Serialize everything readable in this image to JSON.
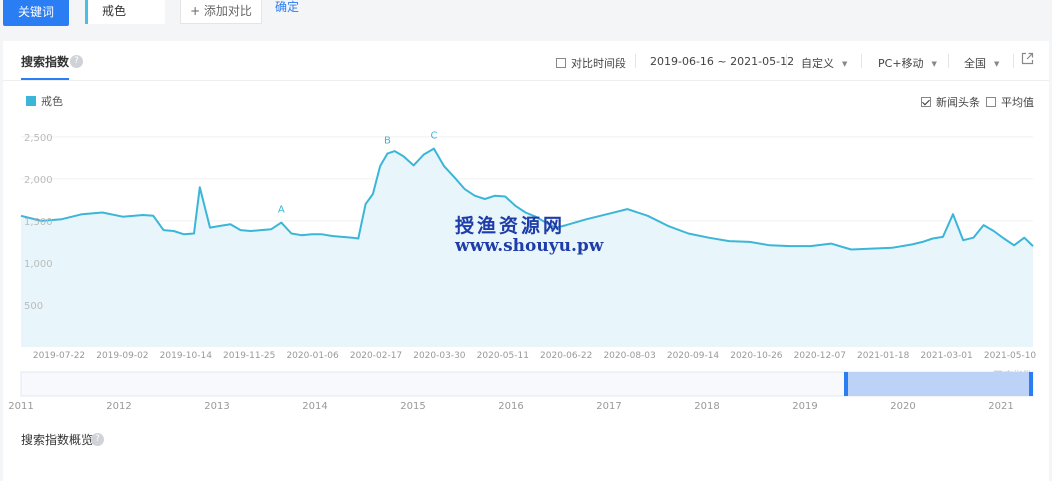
{
  "topbar": {
    "keyword_button": "关键词",
    "keyword_value": "戒色",
    "add_compare": "+ 添加对比",
    "confirm": "确定"
  },
  "panel": {
    "title": "搜索指数",
    "help_icon": "question-circle-icon",
    "compare_period_label": "对比时间段",
    "date_range": "2019-06-16 ~ 2021-05-12",
    "custom_select": "自定义",
    "device_select": "PC+移动",
    "region_select": "全国",
    "export_icon": "external-link-icon",
    "overview_title": "搜索指数概览"
  },
  "chart_options": {
    "news_headlines": {
      "label": "新闻头条",
      "checked": true
    },
    "average": {
      "label": "平均值",
      "checked": false
    }
  },
  "watermark": {
    "line1": "授渔资源网",
    "line2": "www.shouyu.pw"
  },
  "baidu_mark": "@百度指数",
  "colors": {
    "accent": "#2b7df4",
    "series": "#3bb5d8",
    "area_fill": "#e8f6fb",
    "slider_fill": "#bcd3f7"
  },
  "chart_data": {
    "type": "area",
    "title": "",
    "xlabel": "",
    "ylabel": "",
    "ylim": [
      0,
      2700
    ],
    "yticks": [
      "500",
      "1,000",
      "1,500",
      "2,000",
      "2,500"
    ],
    "ytick_values": [
      500,
      1000,
      1500,
      2000,
      2500
    ],
    "xtick_labels": [
      "2019-07-22",
      "2019-09-02",
      "2019-10-14",
      "2019-11-25",
      "2020-01-06",
      "2020-02-17",
      "2020-03-30",
      "2020-05-11",
      "2020-06-22",
      "2020-08-03",
      "2020-09-14",
      "2020-10-26",
      "2020-12-07",
      "2021-01-18",
      "2021-03-01",
      "2021-05-10"
    ],
    "x": [
      "2019-06-16",
      "2019-06-30",
      "2019-07-14",
      "2019-07-28",
      "2019-08-11",
      "2019-08-25",
      "2019-09-08",
      "2019-09-15",
      "2019-09-22",
      "2019-09-29",
      "2019-10-06",
      "2019-10-13",
      "2019-10-17",
      "2019-10-24",
      "2019-10-31",
      "2019-11-07",
      "2019-11-14",
      "2019-11-21",
      "2019-11-28",
      "2019-12-05",
      "2019-12-12",
      "2019-12-19",
      "2019-12-26",
      "2020-01-02",
      "2020-01-09",
      "2020-01-16",
      "2020-01-23",
      "2020-01-30",
      "2020-02-03",
      "2020-02-08",
      "2020-02-13",
      "2020-02-18",
      "2020-02-23",
      "2020-02-28",
      "2020-03-05",
      "2020-03-12",
      "2020-03-19",
      "2020-03-26",
      "2020-04-02",
      "2020-04-09",
      "2020-04-16",
      "2020-04-23",
      "2020-04-30",
      "2020-05-07",
      "2020-05-14",
      "2020-05-21",
      "2020-05-28",
      "2020-06-04",
      "2020-06-11",
      "2020-06-18",
      "2020-06-25",
      "2020-07-09",
      "2020-07-23",
      "2020-08-06",
      "2020-08-20",
      "2020-09-03",
      "2020-09-17",
      "2020-10-01",
      "2020-10-15",
      "2020-10-29",
      "2020-11-12",
      "2020-11-26",
      "2020-12-10",
      "2020-12-24",
      "2021-01-07",
      "2021-01-21",
      "2021-02-04",
      "2021-02-18",
      "2021-02-25",
      "2021-03-04",
      "2021-03-11",
      "2021-03-18",
      "2021-03-25",
      "2021-04-01",
      "2021-04-08",
      "2021-04-15",
      "2021-04-22",
      "2021-04-29",
      "2021-05-06",
      "2021-05-12"
    ],
    "series": [
      {
        "name": "戒色",
        "values": [
          1560,
          1500,
          1520,
          1580,
          1600,
          1550,
          1570,
          1560,
          1390,
          1380,
          1340,
          1350,
          1900,
          1420,
          1440,
          1460,
          1390,
          1380,
          1390,
          1400,
          1480,
          1350,
          1330,
          1340,
          1340,
          1320,
          1310,
          1300,
          1290,
          1700,
          1820,
          2150,
          2300,
          2330,
          2270,
          2160,
          2290,
          2360,
          2150,
          2020,
          1880,
          1800,
          1760,
          1800,
          1790,
          1680,
          1600,
          1550,
          1480,
          1420,
          1450,
          1520,
          1580,
          1640,
          1560,
          1440,
          1350,
          1300,
          1260,
          1250,
          1210,
          1200,
          1200,
          1230,
          1160,
          1170,
          1180,
          1220,
          1250,
          1290,
          1310,
          1580,
          1270,
          1300,
          1450,
          1380,
          1290,
          1210,
          1300,
          1200
        ]
      }
    ],
    "annotations": [
      {
        "label": "A",
        "x": "2019-12-12",
        "y": 1480
      },
      {
        "label": "B",
        "x": "2020-02-23",
        "y": 2300
      },
      {
        "label": "C",
        "x": "2020-03-26",
        "y": 2360
      }
    ],
    "grid": true,
    "legend": "top-left",
    "navigator": {
      "year_labels": [
        "2011",
        "2012",
        "2013",
        "2014",
        "2015",
        "2016",
        "2017",
        "2018",
        "2019",
        "2020",
        "2021"
      ],
      "selected_range": [
        "2019-06-16",
        "2021-05-12"
      ]
    }
  }
}
